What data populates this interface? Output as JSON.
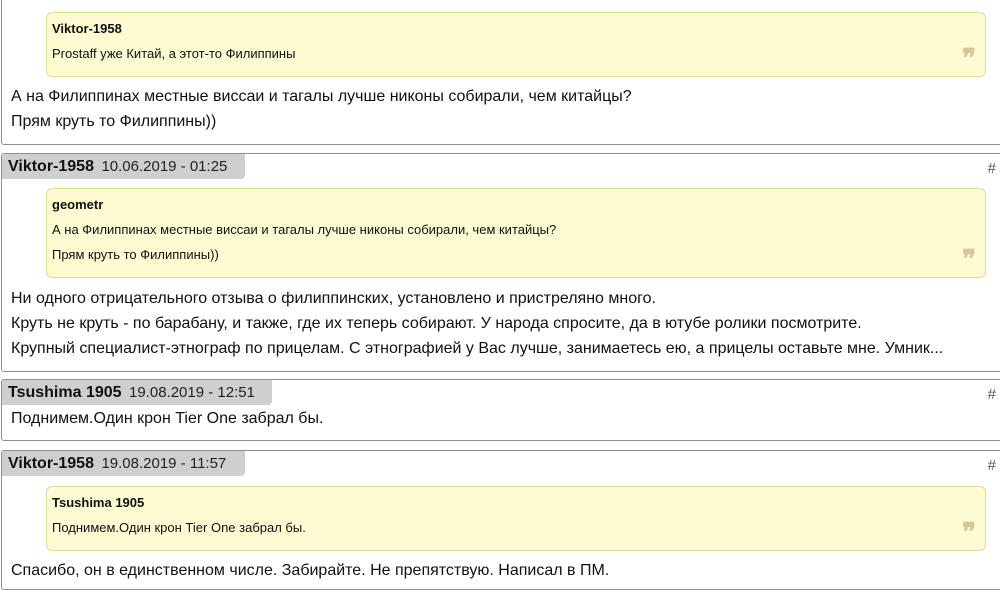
{
  "posts": [
    {
      "quote": {
        "author": "Viktor-1958",
        "lines": [
          "Prostaff уже Китай, а этот-то Филиппины"
        ]
      },
      "lines": [
        "А на Филиппинах местные виссаи и тагалы лучше никоны собирали, чем китайцы?",
        "Прям круть то Филиппины))"
      ]
    },
    {
      "author": "Viktor-1958",
      "date": "10.06.2019 - 01:25",
      "hash": "#",
      "quote": {
        "author": "geometr",
        "lines": [
          "А на Филиппинах местные виссаи и тагалы лучше никоны собирали, чем китайцы?",
          "Прям круть то Филиппины))"
        ]
      },
      "lines": [
        "Ни одного отрицательного отзыва о филиппинских, установлено и пристреляно много.",
        "Круть не круть - по барабану, и также, где их теперь собирают. У народа спросите, да в ютубе ролики посмотрите.",
        "Крупный специалист-этнограф по прицелам. С этнографией у Вас лучше, занимаетесь ею, а прицелы оставьте мне. Умник..."
      ]
    },
    {
      "author": "Tsushima 1905",
      "date": "19.08.2019 - 12:51",
      "hash": "#",
      "lines": [
        "Поднимем.Один крон Tier One забрал бы."
      ]
    },
    {
      "author": "Viktor-1958",
      "date": "19.08.2019 - 11:57",
      "hash": "#",
      "quote": {
        "author": "Tsushima 1905",
        "lines": [
          "Поднимем.Один крон Tier One забрал бы."
        ]
      },
      "lines": [
        "Спасибо, он в единственном числе. Забирайте. Не препятствую. Написал в ПМ."
      ]
    }
  ],
  "icons": {
    "quote_mark": "quote-close-icon"
  }
}
